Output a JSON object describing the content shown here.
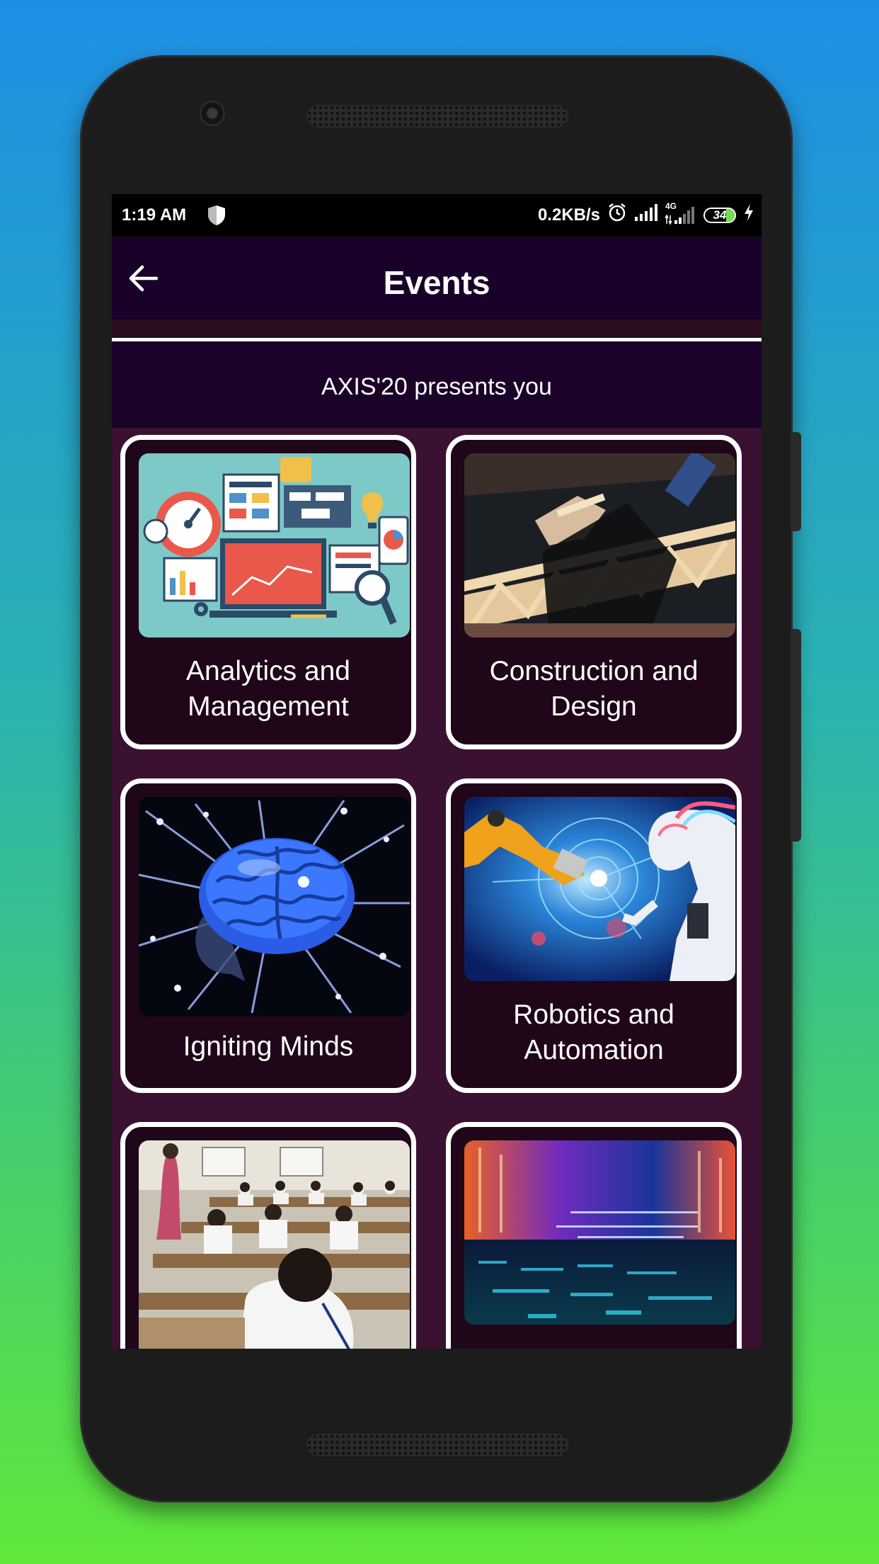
{
  "status_bar": {
    "time": "1:19 AM",
    "network_speed": "0.2KB/s",
    "network_type": "4G",
    "battery": "34",
    "icons": [
      "shield-icon",
      "alarm-icon",
      "signal-icon",
      "signal-4g-icon",
      "battery-icon",
      "charging-icon"
    ]
  },
  "appbar": {
    "title": "Events",
    "back_icon": "arrow-left-icon"
  },
  "subheader": "AXIS'20 presents you",
  "events": [
    {
      "label": "Analytics and Management",
      "image": "analytics-dashboard-illustration"
    },
    {
      "label": "Construction and Design",
      "image": "popsicle-stick-bridge-photo"
    },
    {
      "label": "Igniting Minds",
      "image": "glowing-brain-photo"
    },
    {
      "label": "Robotics and Automation",
      "image": "robot-arm-and-android-photo"
    },
    {
      "label": "",
      "image": "students-in-exam-hall-photo"
    },
    {
      "label": "",
      "image": "digital-code-landscape-photo"
    }
  ],
  "colors": {
    "appbar": "#18022a",
    "subheader": "#1a0228",
    "grid_background": "#3a1130",
    "card_background": "#1f0619",
    "card_border": "#ffffff"
  }
}
